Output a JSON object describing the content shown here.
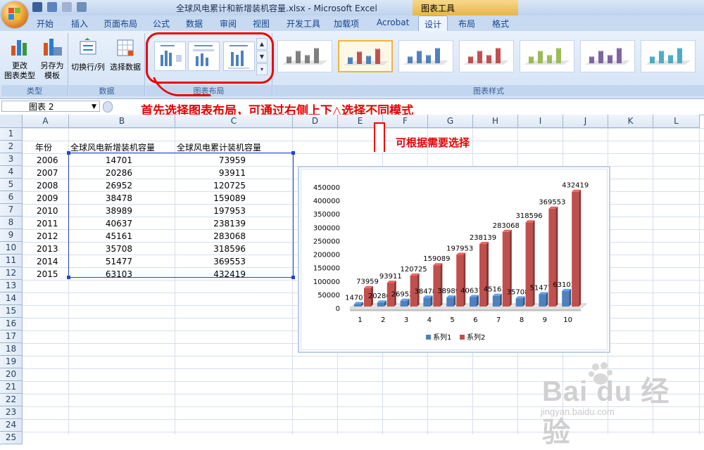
{
  "window": {
    "title": "全球风电累计和新增装机容量.xlsx - Microsoft Excel",
    "context_tab": "图表工具"
  },
  "tabs": [
    "开始",
    "插入",
    "页面布局",
    "公式",
    "数据",
    "审阅",
    "视图",
    "开发工具",
    "加载项",
    "Acrobat",
    "设计",
    "布局",
    "格式"
  ],
  "active_tab": "设计",
  "ribbon": {
    "type_group": {
      "label": "类型",
      "change_type": "更改\n图表类型",
      "save_template": "另存为\n模板"
    },
    "data_group": {
      "label": "数据",
      "switch_row_col": "切换行/列",
      "select_data": "选择数据"
    },
    "layout_group": {
      "label": "图表布局"
    },
    "style_group": {
      "label": "图表样式"
    },
    "style_colors": [
      "#7f7f7f",
      "#4f81bd",
      "#4f81bd",
      "#c0504d",
      "#9bbb59",
      "#8064a2",
      "#4bacc6"
    ]
  },
  "formula_bar": {
    "name_box": "图表 2"
  },
  "annotations": {
    "top": "首先选择图表布局，可通过右侧上下△选择不同模式",
    "right": "可根据需要选择"
  },
  "columns": [
    "A",
    "B",
    "C",
    "D",
    "E",
    "F",
    "G",
    "H",
    "I",
    "J",
    "K",
    "L"
  ],
  "rows": [
    "1",
    "2",
    "3",
    "4",
    "5",
    "6",
    "7",
    "8",
    "9",
    "10",
    "11",
    "12",
    "13",
    "14",
    "15",
    "16",
    "17",
    "18",
    "19",
    "20",
    "21",
    "22",
    "23",
    "24",
    "25"
  ],
  "sheet": {
    "headers": {
      "year": "年份",
      "new": "全球风电新增装机容量",
      "total": "全球风电累计装机容量"
    },
    "data": [
      [
        "2006",
        "14701",
        "73959"
      ],
      [
        "2007",
        "20286",
        "93911"
      ],
      [
        "2008",
        "26952",
        "120725"
      ],
      [
        "2009",
        "38478",
        "159089"
      ],
      [
        "2010",
        "38989",
        "197953"
      ],
      [
        "2011",
        "40637",
        "238139"
      ],
      [
        "2012",
        "45161",
        "283068"
      ],
      [
        "2013",
        "35708",
        "318596"
      ],
      [
        "2014",
        "51477",
        "369553"
      ],
      [
        "2015",
        "63103",
        "432419"
      ]
    ]
  },
  "chart_data": {
    "type": "bar",
    "categories": [
      "1",
      "2",
      "3",
      "4",
      "5",
      "6",
      "7",
      "8",
      "9",
      "10"
    ],
    "series": [
      {
        "name": "系列1",
        "values": [
          14701,
          20286,
          26952,
          38478,
          38989,
          40637,
          45161,
          35708,
          51477,
          63103
        ],
        "color": "#4f81bd"
      },
      {
        "name": "系列2",
        "values": [
          73959,
          93911,
          120725,
          159089,
          197953,
          238139,
          283068,
          318596,
          369553,
          432419
        ],
        "color": "#c0504d"
      }
    ],
    "yticks": [
      "450000",
      "400000",
      "350000",
      "300000",
      "250000",
      "200000",
      "150000",
      "100000",
      "50000",
      "0"
    ],
    "ylim": [
      0,
      450000
    ],
    "legend": "bottom",
    "grid": false
  },
  "watermark": {
    "brand": "Bai du 经验",
    "url": "jingyan.baidu.com"
  }
}
